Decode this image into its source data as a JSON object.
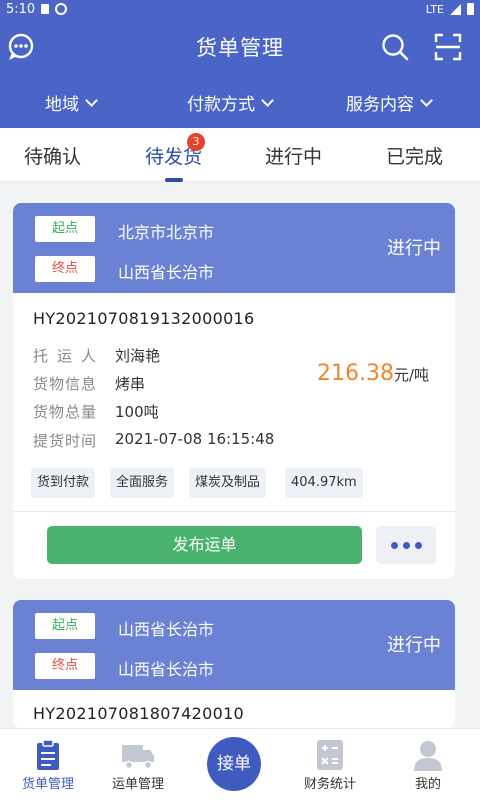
{
  "status_bar": {
    "time": "5:10",
    "network": "LTE"
  },
  "header": {
    "title": "货单管理",
    "filters": [
      {
        "label": "地域"
      },
      {
        "label": "付款方式"
      },
      {
        "label": "服务内容"
      }
    ]
  },
  "tabs": [
    {
      "label": "待确认"
    },
    {
      "label": "待发货",
      "badge": "3",
      "active": true
    },
    {
      "label": "进行中"
    },
    {
      "label": "已完成"
    }
  ],
  "cards": [
    {
      "start_tag": "起点",
      "start_city": "北京市北京市",
      "end_tag": "终点",
      "end_city": "山西省长治市",
      "status": "进行中",
      "order_no": "HY2021070819132000016",
      "shipper_label": "托运人",
      "shipper": "刘海艳",
      "goods_label": "货物信息",
      "goods": "烤串",
      "total_label": "货物总量",
      "total": "100吨",
      "pickup_label": "提货时间",
      "pickup_time": "2021-07-08 16:15:48",
      "price": "216.38",
      "price_unit": "元/吨",
      "tags": [
        "货到付款",
        "全面服务",
        "煤炭及制品",
        "404.97km"
      ],
      "publish_label": "发布运单"
    },
    {
      "start_tag": "起点",
      "start_city": "山西省长治市",
      "end_tag": "终点",
      "end_city": "山西省长治市",
      "status": "进行中",
      "order_no": "HY202107081807420010"
    }
  ],
  "bottom_nav": [
    {
      "label": "货单管理",
      "active": true
    },
    {
      "label": "运单管理"
    },
    {
      "label": "接单"
    },
    {
      "label": "财务统计"
    },
    {
      "label": "我的"
    }
  ],
  "colors": {
    "primary": "#4a64c7",
    "card_header": "#6b82d4",
    "accent_price": "#f0862f",
    "publish_green": "#49b36d",
    "badge_red": "#e8412d"
  }
}
